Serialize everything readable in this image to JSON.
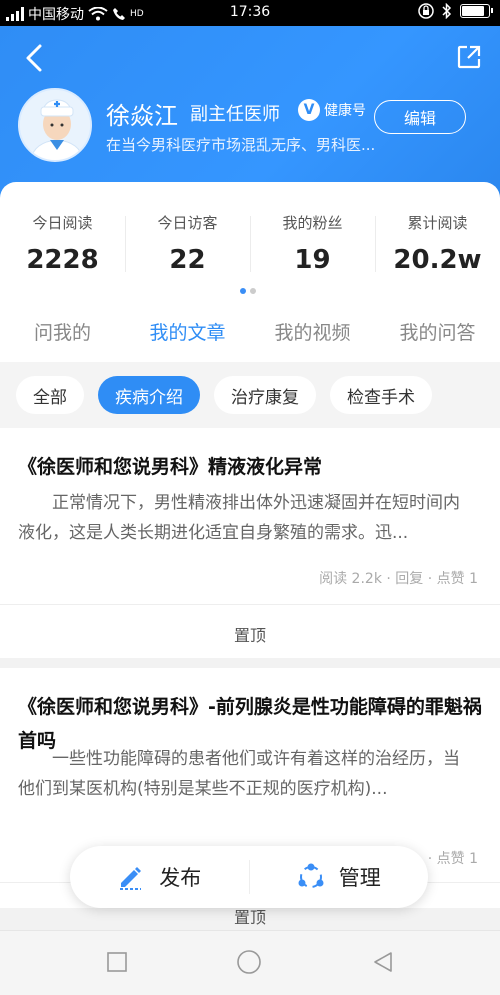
{
  "status_bar": {
    "carrier": "中国移动",
    "hd": "HD",
    "time": "17:36"
  },
  "profile": {
    "name": "徐焱江",
    "title": "副主任医师",
    "badge": "健康号",
    "edit_label": "编辑",
    "intro": "在当今男科医疗市场混乱无序、男科医..."
  },
  "stats": [
    {
      "label": "今日阅读",
      "value": "2228"
    },
    {
      "label": "今日访客",
      "value": "22"
    },
    {
      "label": "我的粉丝",
      "value": "19"
    },
    {
      "label": "累计阅读",
      "value": "20.2w"
    }
  ],
  "tabs": [
    {
      "label": "问我的",
      "active": false
    },
    {
      "label": "我的文章",
      "active": true
    },
    {
      "label": "我的视频",
      "active": false
    },
    {
      "label": "我的问答",
      "active": false
    }
  ],
  "filters": [
    {
      "label": "全部",
      "active": false
    },
    {
      "label": "疾病介绍",
      "active": true
    },
    {
      "label": "治疗康复",
      "active": false
    },
    {
      "label": "检查手术",
      "active": false
    }
  ],
  "articles": [
    {
      "title": "《徐医师和您说男科》精液液化异常",
      "body": "正常情况下，男性精液排出体外迅速凝固并在短时间内液化，这是人类长期进化适宜自身繁殖的需求。迅...",
      "meta": "阅读 2.2k · 回复 · 点赞 1",
      "pin": "置顶"
    },
    {
      "title": "《徐医师和您说男科》-前列腺炎是性功能障碍的罪魁祸首吗",
      "body": "一些性功能障碍的患者他们或许有着这样的治经历，当他们到某医机构(特别是某些不正规的医疗机构)...",
      "meta": "· 点赞 1",
      "pin": "置顶"
    }
  ],
  "actions": {
    "publish": "发布",
    "manage": "管理"
  },
  "colors": {
    "accent": "#2f8df5"
  }
}
